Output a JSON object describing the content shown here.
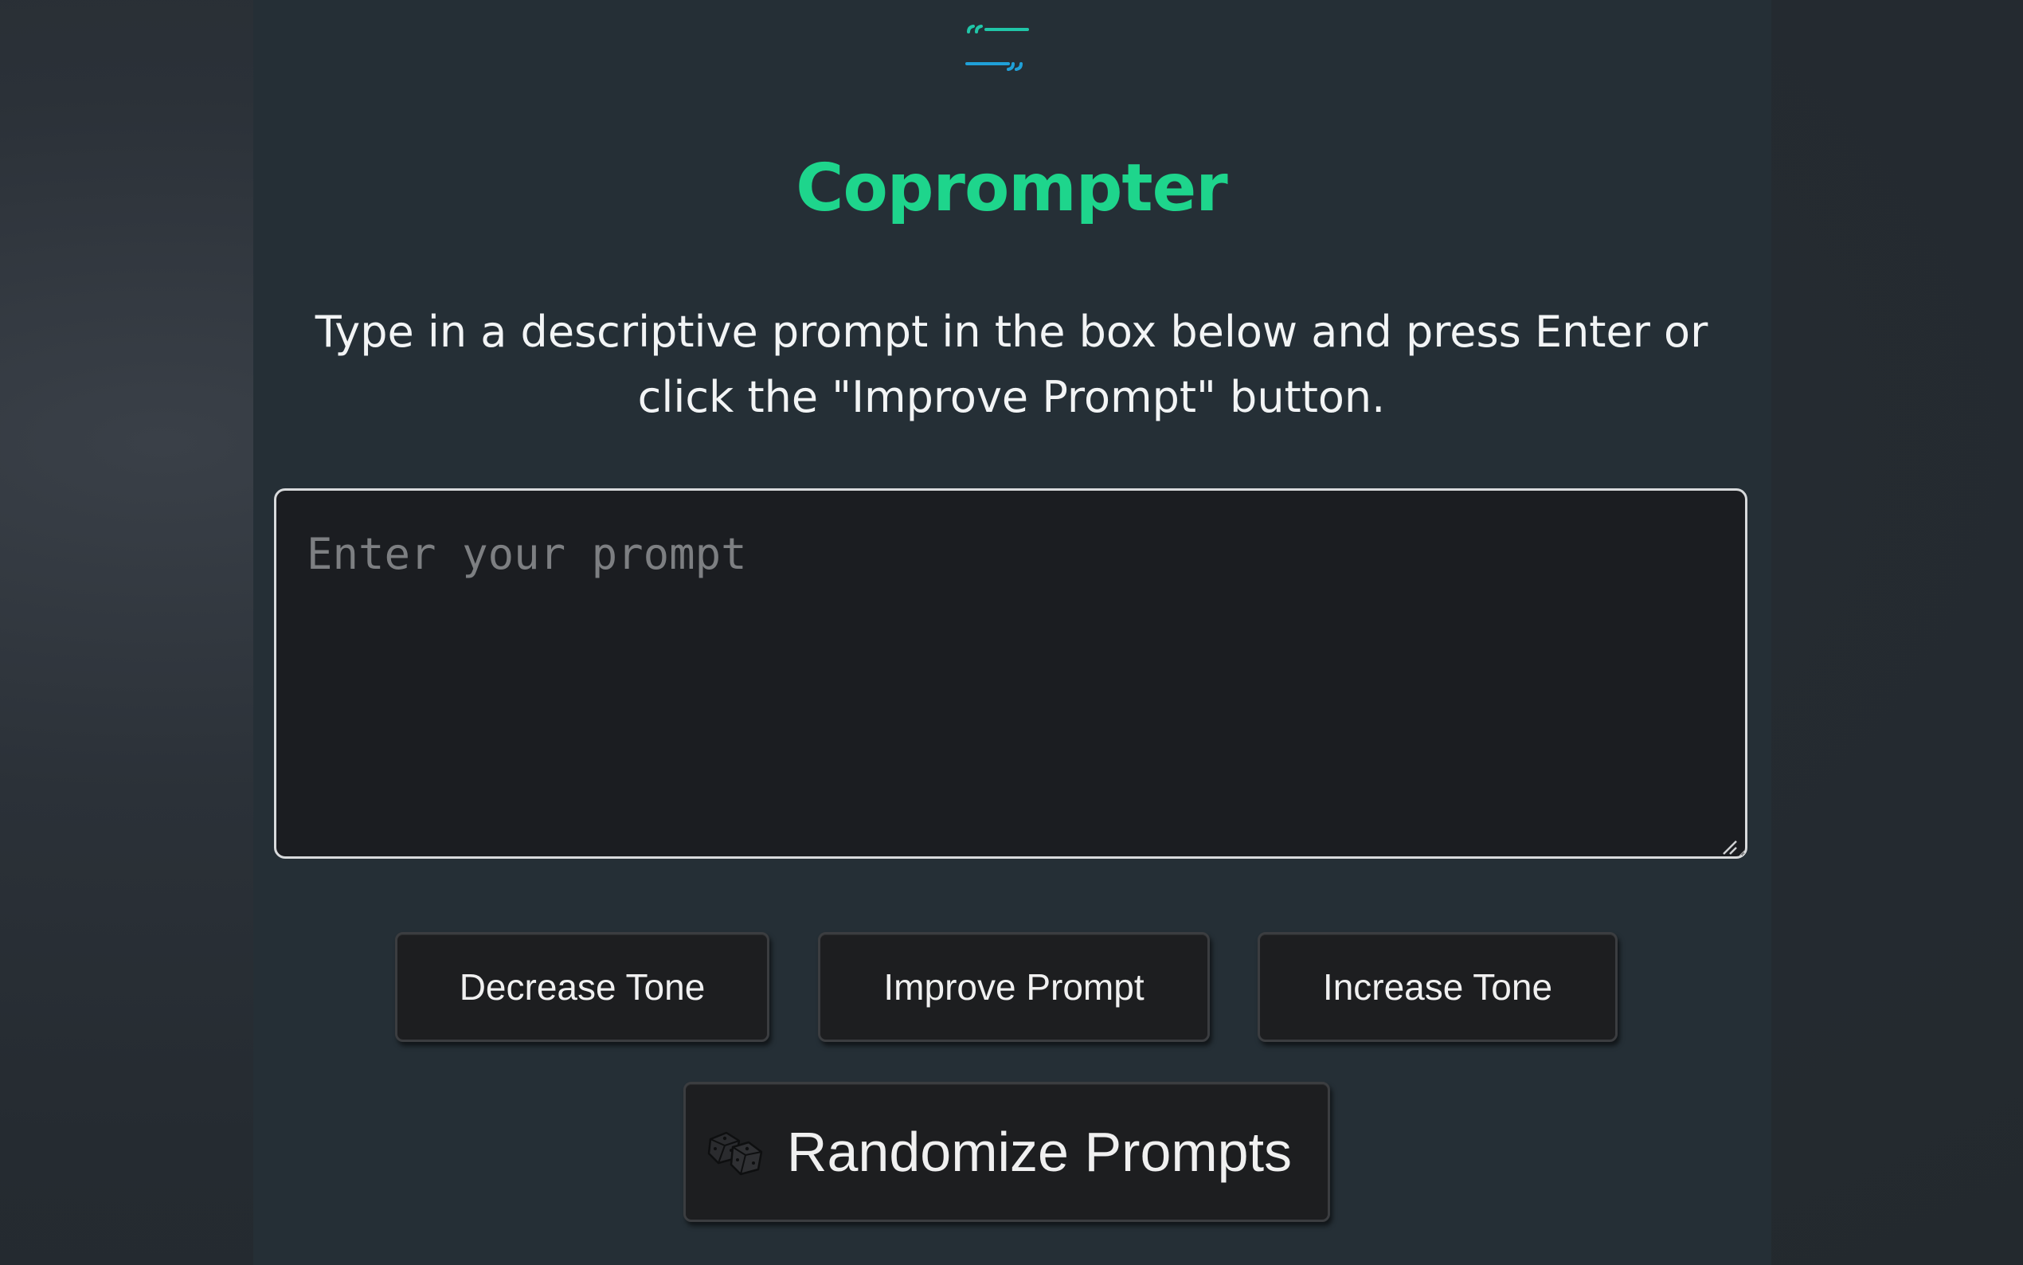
{
  "app": {
    "logo_icon": "quote-lines-icon",
    "title": "Coprompter",
    "instructions": "Type in a descriptive prompt in the box below and press Enter or click the \"Improve Prompt\" button."
  },
  "prompt": {
    "value": "",
    "placeholder": "Enter your prompt"
  },
  "buttons": {
    "decrease_tone": "Decrease Tone",
    "improve_prompt": "Improve Prompt",
    "increase_tone": "Increase Tone",
    "randomize_prompts": "Randomize Prompts",
    "randomize_icon": "dice-icon"
  },
  "colors": {
    "accent": "#1ed58c",
    "logo_teal": "#20c6a8",
    "logo_blue": "#1fa0d8",
    "panel": "#252f36",
    "input_bg": "#1b1d21",
    "button_bg": "#1d1e20"
  }
}
